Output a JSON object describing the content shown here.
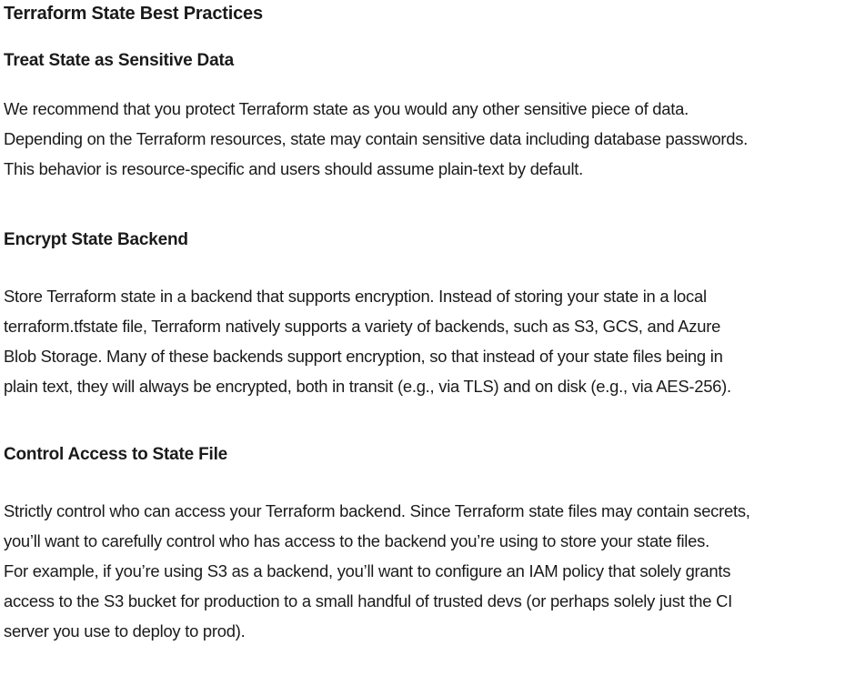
{
  "document": {
    "title": "Terraform State Best Practices",
    "sections": [
      {
        "heading": "Treat State as Sensitive Data",
        "lines": [
          "We recommend that you protect Terraform state as you would any other sensitive piece of data.",
          "Depending on the Terraform resources, state may contain sensitive data including database passwords.",
          "This behavior is resource-specific and users should assume plain-text by default."
        ]
      },
      {
        "heading": "Encrypt State Backend",
        "lines": [
          "Store Terraform state in a backend that supports encryption. Instead of storing your state in a local",
          "terraform.tfstate file, Terraform natively supports a variety of backends, such as S3, GCS, and Azure",
          "Blob Storage. Many of these backends support encryption, so that instead of your state files being in",
          "plain text, they will always be encrypted, both in transit (e.g., via TLS) and on disk (e.g., via AES-256)."
        ]
      },
      {
        "heading": "Control Access to State File",
        "lines": [
          "Strictly control who can access your Terraform backend. Since Terraform state files may contain secrets,",
          "you’ll want to carefully control who has access to the backend you’re using to store your state files.",
          "For example, if you’re using S3 as a backend, you’ll want to configure an IAM policy that solely grants",
          "access to the S3 bucket for production to a small handful of trusted devs (or perhaps solely just the CI",
          "server you use to deploy to prod)."
        ]
      }
    ]
  }
}
